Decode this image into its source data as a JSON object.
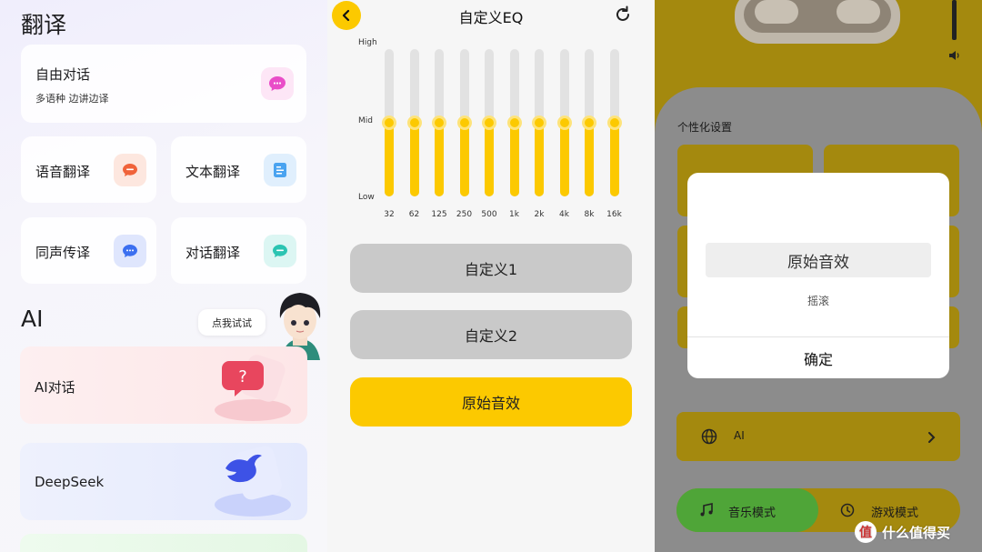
{
  "left": {
    "translate_title": "翻译",
    "free_talk": {
      "title": "自由对话",
      "subtitle": "多语种 边讲边译"
    },
    "voice_translate": "语音翻译",
    "text_translate": "文本翻译",
    "simultaneous": "同声传译",
    "dialog_translate": "对话翻译",
    "ai_title": "AI",
    "tooltip": "点我试试",
    "ai_chat": "AI对话",
    "deepseek": "DeepSeek"
  },
  "middle": {
    "title": "自定义EQ",
    "levels": {
      "high": "High",
      "mid": "Mid",
      "low": "Low"
    },
    "bands": [
      {
        "freq": "32",
        "level": 0.5
      },
      {
        "freq": "62",
        "level": 0.5
      },
      {
        "freq": "125",
        "level": 0.5
      },
      {
        "freq": "250",
        "level": 0.5
      },
      {
        "freq": "500",
        "level": 0.5
      },
      {
        "freq": "1k",
        "level": 0.5
      },
      {
        "freq": "2k",
        "level": 0.5
      },
      {
        "freq": "4k",
        "level": 0.5
      },
      {
        "freq": "8k",
        "level": 0.5
      },
      {
        "freq": "16k",
        "level": 0.5
      }
    ],
    "presets": [
      "自定义1",
      "自定义2",
      "原始音效"
    ],
    "selected_preset": "原始音效",
    "accent_color": "#fcc900"
  },
  "right": {
    "section_title": "个性化设置",
    "dialog": {
      "option_selected": "原始音效",
      "option_other": "摇滚",
      "confirm": "确定"
    },
    "ai_row_label": "AI",
    "mode_music": "音乐模式",
    "mode_game": "游戏模式"
  },
  "watermark": {
    "badge": "值",
    "text": "什么值得买"
  }
}
